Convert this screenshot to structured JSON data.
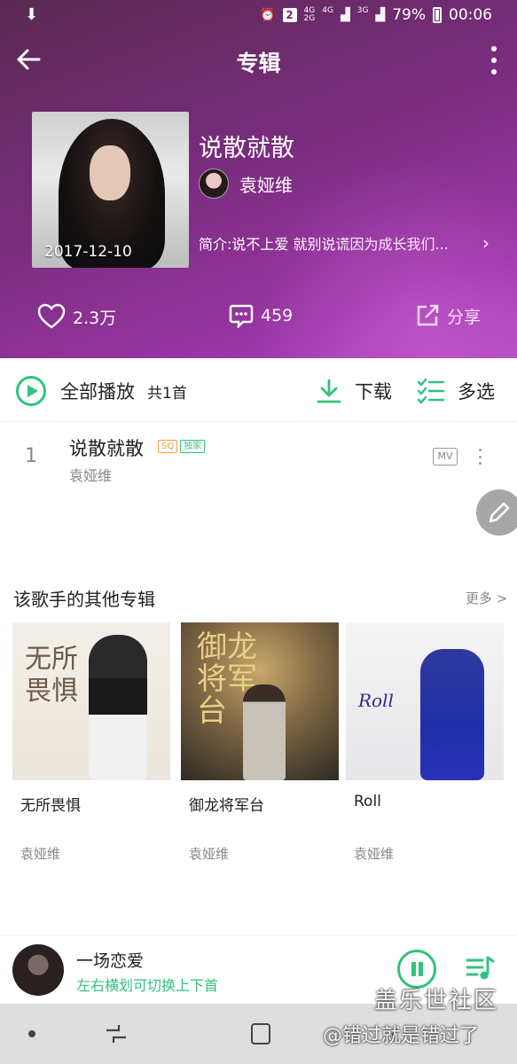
{
  "status_bar": {
    "battery": "79%",
    "time": "00:06",
    "sim_badge": "2",
    "net1": "4G",
    "net2": "4G",
    "net3": "2G",
    "net4": "3G"
  },
  "header": {
    "title": "专辑"
  },
  "album": {
    "title": "说散就散",
    "artist": "袁娅维",
    "release_date": "2017-12-10",
    "description": "简介:说不上爱 就别说谎因为成长我们..."
  },
  "stats": {
    "likes": "2.3万",
    "comments": "459",
    "share_label": "分享"
  },
  "play_bar": {
    "play_all_label": "全部播放",
    "count_label": "共1首",
    "download_label": "下载",
    "multiselect_label": "多选"
  },
  "songs": [
    {
      "index": "1",
      "title": "说散就散",
      "badge_quality": "SQ",
      "badge_exclusive": "独家",
      "artist": "袁娅维",
      "mv_label": "MV"
    }
  ],
  "other_albums": {
    "section_title": "该歌手的其他专辑",
    "more_label": "更多 >",
    "items": [
      {
        "name": "无所畏惧",
        "artist": "袁娅维",
        "cover_text": "无所畏惧"
      },
      {
        "name": "御龙将军台",
        "artist": "袁娅维",
        "cover_text": "御龙将军台"
      },
      {
        "name": "Roll",
        "artist": "袁娅维",
        "cover_text": "Roll"
      }
    ]
  },
  "mini_player": {
    "title": "一场恋爱",
    "hint": "左右横划可切换上下首"
  },
  "watermark": {
    "line1": "盖乐世社区",
    "line2": "@错过就是错过了"
  },
  "colors": {
    "accent_green": "#31c27c",
    "hero_purple": "#7a2c7e"
  }
}
